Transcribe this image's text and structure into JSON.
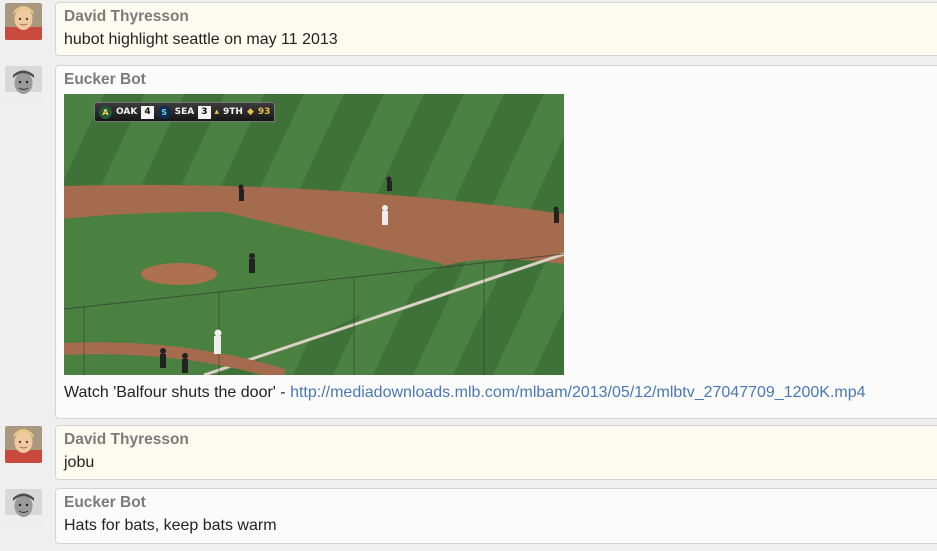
{
  "messages": [
    {
      "author": "David Thyresson",
      "text": "hubot highlight seattle on may 11 2013"
    },
    {
      "author": "Eucker Bot",
      "video": {
        "scorebug": {
          "away_team": "OAK",
          "away_score": "4",
          "home_team": "SEA",
          "home_score": "3",
          "inning": "9TH",
          "pitch_count": "93"
        }
      },
      "caption": "Watch 'Balfour shuts the door' - ",
      "link": "http://mediadownloads.mlb.com/mlbam/2013/05/12/mlbtv_27047709_1200K.mp4"
    },
    {
      "author": "David Thyresson",
      "text": "jobu"
    },
    {
      "author": "Eucker Bot",
      "text": "Hats for bats, keep bats warm"
    }
  ],
  "colors": {
    "link": "#4a78b5",
    "user_bubble": "#fdfbef",
    "bot_bubble": "#fbfbfb",
    "author": "#7b7b7b"
  }
}
